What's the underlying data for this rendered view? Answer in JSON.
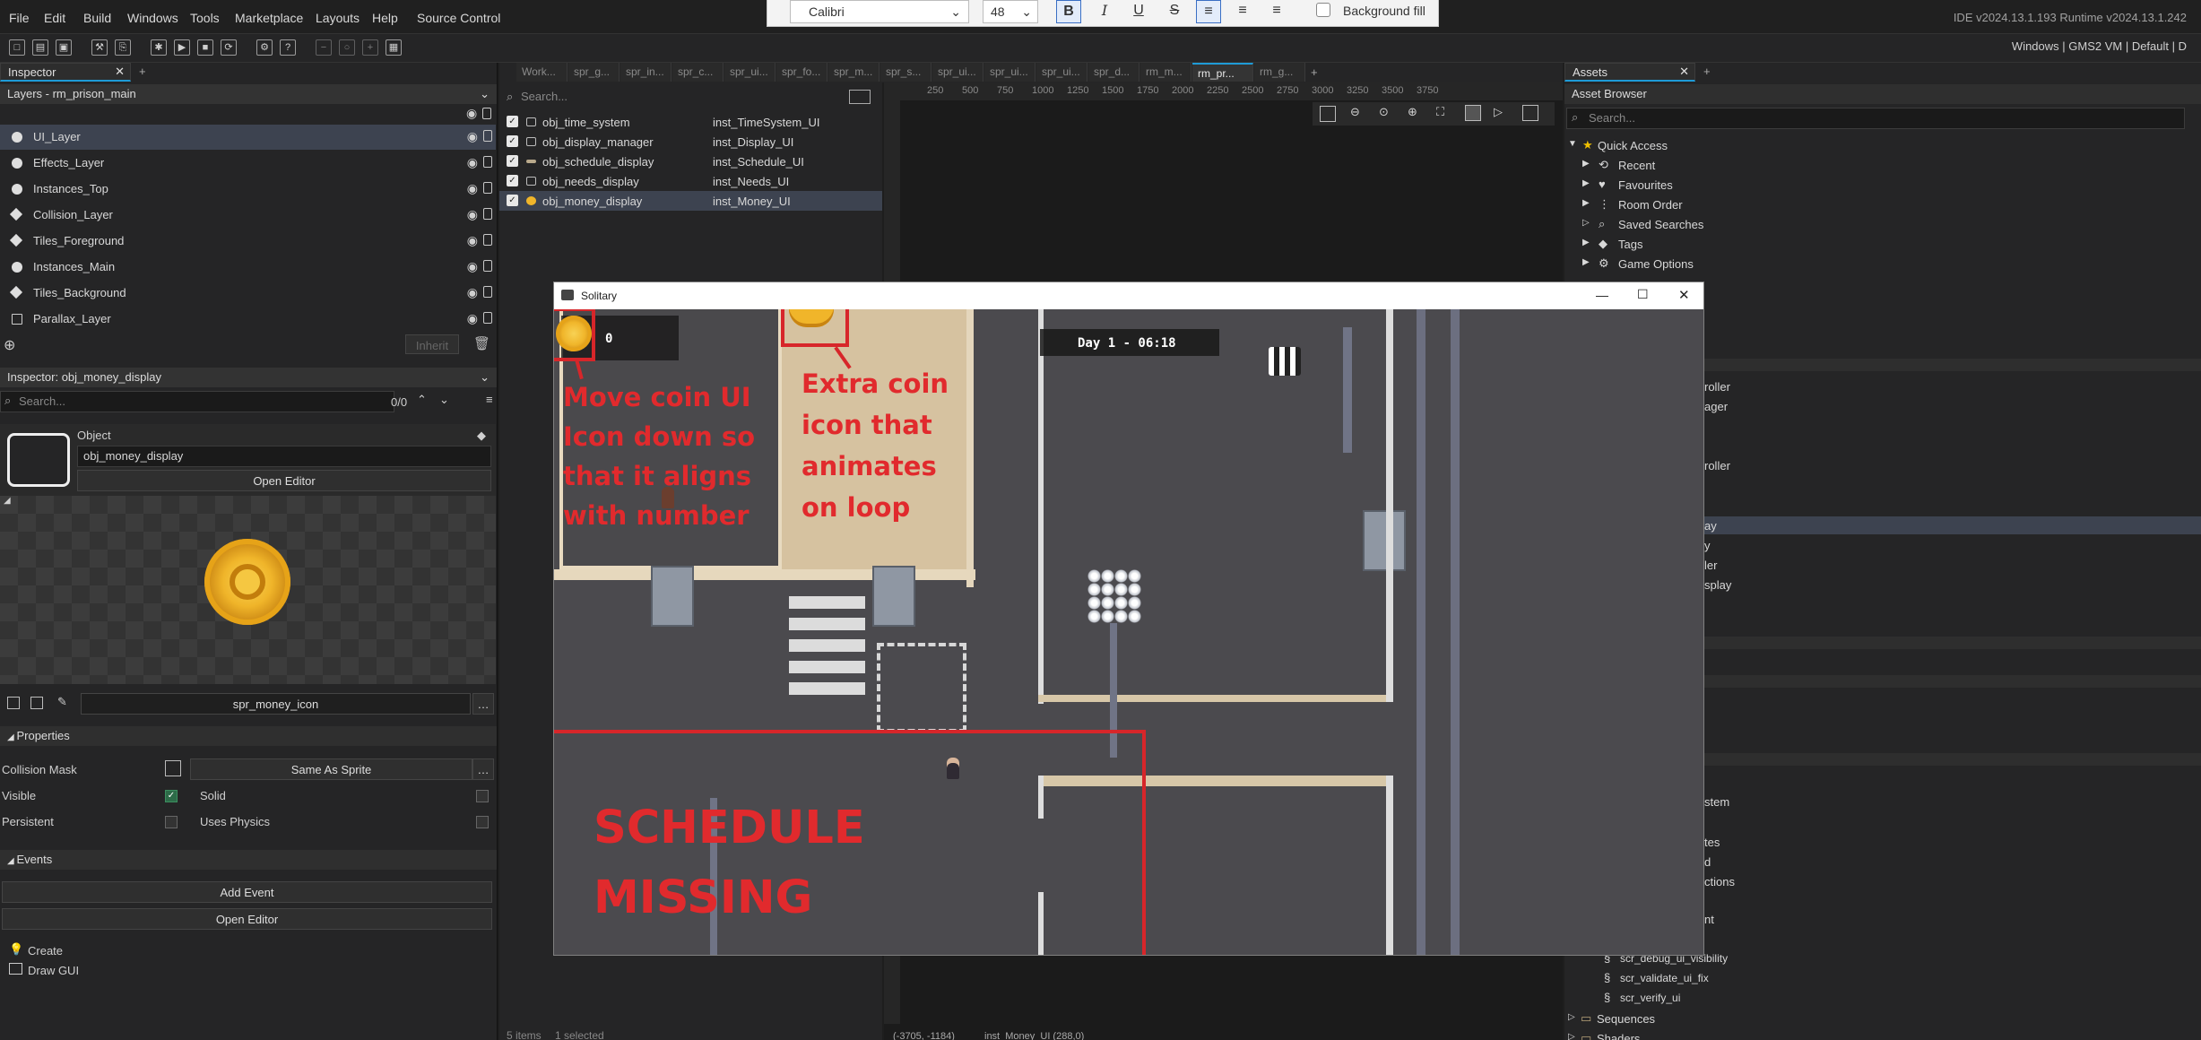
{
  "menubar": {
    "items": [
      "File",
      "Edit",
      "Build",
      "Windows",
      "Tools",
      "Marketplace",
      "Layouts",
      "Help",
      "Source Control"
    ],
    "version": "IDE v2024.13.1.193  Runtime v2024.13.1.242",
    "target": "Windows | GMS2 VM | Default | D"
  },
  "format_bar": {
    "font": "Calibri",
    "size": "48",
    "bold": "B",
    "italic": "I",
    "underline": "U",
    "strike": "S",
    "background_fill": "Background fill"
  },
  "inspector": {
    "tab": "Inspector",
    "layers_header": "Layers - rm_prison_main",
    "layers": [
      {
        "name": "UI_Layer",
        "selected": true
      },
      {
        "name": "Effects_Layer"
      },
      {
        "name": "Instances_Top"
      },
      {
        "name": "Collision_Layer"
      },
      {
        "name": "Tiles_Foreground"
      },
      {
        "name": "Instances_Main"
      },
      {
        "name": "Tiles_Background"
      },
      {
        "name": "Parallax_Layer"
      }
    ],
    "inherit": "Inherit",
    "object_header": "Inspector: obj_money_display",
    "search_placeholder": "Search...",
    "search_count": "0/0",
    "object_label": "Object",
    "object_name": "obj_money_display",
    "open_editor": "Open Editor",
    "sprite_name": "spr_money_icon",
    "properties_header": "Properties",
    "collision_mask_label": "Collision Mask",
    "collision_mask_value": "Same As Sprite",
    "visible_label": "Visible",
    "solid_label": "Solid",
    "persistent_label": "Persistent",
    "uses_physics_label": "Uses Physics",
    "events_header": "Events",
    "add_event": "Add Event",
    "open_editor_2": "Open Editor",
    "events": [
      "Create",
      "Draw GUI"
    ]
  },
  "instances": {
    "search_placeholder": "Search...",
    "rows": [
      {
        "object": "obj_time_system",
        "instance": "inst_TimeSystem_UI"
      },
      {
        "object": "obj_display_manager",
        "instance": "inst_Display_UI"
      },
      {
        "object": "obj_schedule_display",
        "instance": "inst_Schedule_UI"
      },
      {
        "object": "obj_needs_display",
        "instance": "inst_Needs_UI"
      },
      {
        "object": "obj_money_display",
        "instance": "inst_Money_UI",
        "selected": true
      }
    ],
    "footer_items": "5 items",
    "footer_selected": "1 selected"
  },
  "room_editor": {
    "tabs": [
      "Work...",
      "spr_g...",
      "spr_in...",
      "spr_c...",
      "spr_ui...",
      "spr_fo...",
      "spr_m...",
      "spr_s...",
      "spr_ui...",
      "spr_ui...",
      "spr_ui...",
      "spr_d...",
      "rm_m...",
      "rm_pr...",
      "rm_g..."
    ],
    "active_tab": "rm_pr...",
    "ruler": [
      "250",
      "500",
      "750",
      "1000",
      "1250",
      "1500",
      "1750",
      "2000",
      "2250",
      "2500",
      "2750",
      "3000",
      "3250",
      "3500",
      "3750"
    ],
    "status_coords": "(-3705, -1184)",
    "status_inst": "inst_Money_UI (288,0)"
  },
  "assets": {
    "tab": "Assets",
    "header": "Asset Browser",
    "search_placeholder": "Search...",
    "quick_access": "Quick Access",
    "quick_items": [
      "Recent",
      "Favourites",
      "Room Order",
      "Saved Searches",
      "Tags",
      "Game Options"
    ],
    "partial_items": [
      "roller",
      "ager",
      "roller",
      "ay",
      "y",
      "ler",
      "splay",
      "stem",
      "tes",
      "d",
      "ctions",
      "nt"
    ],
    "scripts": [
      "scr_debug_ui_visibility",
      "scr_validate_ui_fix",
      "scr_verify_ui"
    ],
    "folders": [
      "Sequences",
      "Shaders"
    ]
  },
  "game_window": {
    "title": "Solitary",
    "money": "0",
    "clock": "Day 1 - 06:18"
  },
  "annotations": {
    "move_coin": "Move coin UI Icon down so that it aligns with number",
    "extra_coin": "Extra coin icon that animates on loop",
    "schedule_missing": "SCHEDULE MISSING",
    "color": "#d7262a"
  }
}
